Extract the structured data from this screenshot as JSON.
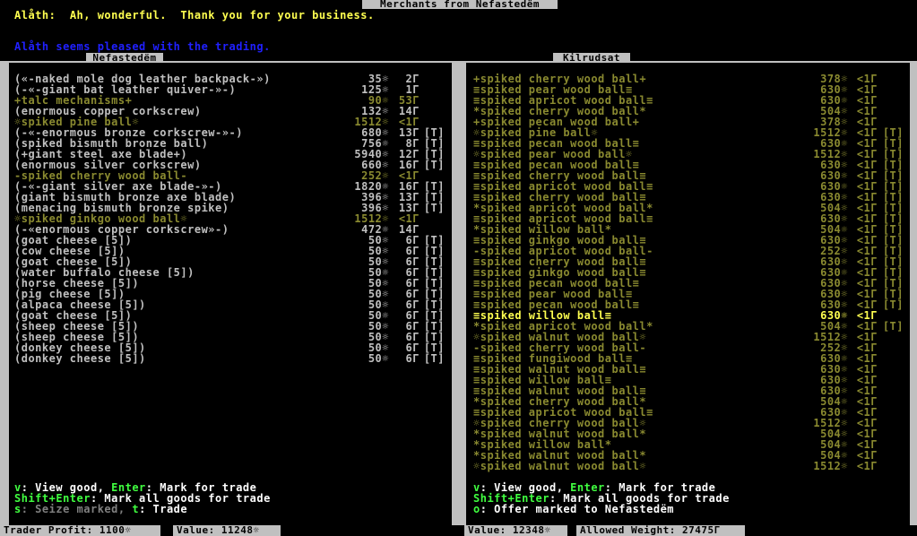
{
  "title": "Merchants from Nefastedëm",
  "messages": {
    "line1_speaker": "Alåth:",
    "line1_text": "Ah, wonderful.  Thank you for your business.",
    "line2": "Alåth seems pleased with the trading."
  },
  "left_panel": {
    "title": "Nefastedëm",
    "items": [
      {
        "name": "(«-naked mole dog leather backpack-»)",
        "value": "35☼",
        "weight": "2Γ",
        "flag": "",
        "color": "#c0c0c0"
      },
      {
        "name": "(-«-giant bat leather quiver-»-)",
        "value": "125☼",
        "weight": "1Γ",
        "flag": "",
        "color": "#c0c0c0"
      },
      {
        "name": "+talc mechanisms+",
        "value": "90☼",
        "weight": "53Γ",
        "flag": "",
        "color": "#8a8a30"
      },
      {
        "name": "(enormous copper corkscrew)",
        "value": "132☼",
        "weight": "14Γ",
        "flag": "",
        "color": "#c0c0c0"
      },
      {
        "name": "☼spiked pine ball☼",
        "value": "1512☼",
        "weight": "<1Γ",
        "flag": "",
        "color": "#8a8a30"
      },
      {
        "name": "(-«-enormous bronze corkscrew-»-)",
        "value": "680☼",
        "weight": "13Γ",
        "flag": "[T]",
        "color": "#c0c0c0"
      },
      {
        "name": "(spiked bismuth bronze ball)",
        "value": "756☼",
        "weight": "8Γ",
        "flag": "[T]",
        "color": "#c0c0c0"
      },
      {
        "name": "(+giant steel axe blade+)",
        "value": "5940☼",
        "weight": "12Γ",
        "flag": "[T]",
        "color": "#c0c0c0"
      },
      {
        "name": "(enormous silver corkscrew)",
        "value": "660☼",
        "weight": "16Γ",
        "flag": "[T]",
        "color": "#c0c0c0"
      },
      {
        "name": "-spiked cherry wood ball-",
        "value": "252☼",
        "weight": "<1Γ",
        "flag": "",
        "color": "#8a8a30"
      },
      {
        "name": "(-«-giant silver axe blade-»-)",
        "value": "1820☼",
        "weight": "16Γ",
        "flag": "[T]",
        "color": "#c0c0c0"
      },
      {
        "name": "(giant bismuth bronze axe blade)",
        "value": "396☼",
        "weight": "13Γ",
        "flag": "[T]",
        "color": "#c0c0c0"
      },
      {
        "name": "(menacing bismuth bronze spike)",
        "value": "396☼",
        "weight": "13Γ",
        "flag": "[T]",
        "color": "#c0c0c0"
      },
      {
        "name": "☼spiked ginkgo wood ball☼",
        "value": "1512☼",
        "weight": "<1Γ",
        "flag": "",
        "color": "#8a8a30"
      },
      {
        "name": "(-«enormous copper corkscrew»-)",
        "value": "472☼",
        "weight": "14Γ",
        "flag": "",
        "color": "#c0c0c0"
      },
      {
        "name": "(goat cheese [5])",
        "value": "50☼",
        "weight": "6Γ",
        "flag": "[T]",
        "color": "#c0c0c0"
      },
      {
        "name": "(cow cheese [5])",
        "value": "50☼",
        "weight": "6Γ",
        "flag": "[T]",
        "color": "#c0c0c0"
      },
      {
        "name": "(goat cheese [5])",
        "value": "50☼",
        "weight": "6Γ",
        "flag": "[T]",
        "color": "#c0c0c0"
      },
      {
        "name": "(water buffalo cheese [5])",
        "value": "50☼",
        "weight": "6Γ",
        "flag": "[T]",
        "color": "#c0c0c0"
      },
      {
        "name": "(horse cheese [5])",
        "value": "50☼",
        "weight": "6Γ",
        "flag": "[T]",
        "color": "#c0c0c0"
      },
      {
        "name": "(pig cheese [5])",
        "value": "50☼",
        "weight": "6Γ",
        "flag": "[T]",
        "color": "#c0c0c0"
      },
      {
        "name": "(alpaca cheese [5])",
        "value": "50☼",
        "weight": "6Γ",
        "flag": "[T]",
        "color": "#c0c0c0"
      },
      {
        "name": "(goat cheese [5])",
        "value": "50☼",
        "weight": "6Γ",
        "flag": "[T]",
        "color": "#c0c0c0"
      },
      {
        "name": "(sheep cheese [5])",
        "value": "50☼",
        "weight": "6Γ",
        "flag": "[T]",
        "color": "#c0c0c0"
      },
      {
        "name": "(sheep cheese [5])",
        "value": "50☼",
        "weight": "6Γ",
        "flag": "[T]",
        "color": "#c0c0c0"
      },
      {
        "name": "(donkey cheese [5])",
        "value": "50☼",
        "weight": "6Γ",
        "flag": "[T]",
        "color": "#c0c0c0"
      },
      {
        "name": "(donkey cheese [5])",
        "value": "50☼",
        "weight": "6Γ",
        "flag": "[T]",
        "color": "#c0c0c0"
      }
    ],
    "help": {
      "l1_key1": "v",
      "l1_t1": ": View good, ",
      "l1_key2": "Enter",
      "l1_t2": ": Mark for trade",
      "l2_key": "Shift+Enter",
      "l2_t": ": Mark all goods for trade",
      "l3_key1": "s",
      "l3_t1": ": Seize marked, ",
      "l3_key2": "t",
      "l3_t2": ": Trade"
    }
  },
  "right_panel": {
    "title": "Kilrudsat",
    "items": [
      {
        "name": "+spiked cherry wood ball+",
        "value": "378☼",
        "weight": "<1Γ",
        "flag": "",
        "color": "#8a8a30"
      },
      {
        "name": "≡spiked pear wood ball≡",
        "value": "630☼",
        "weight": "<1Γ",
        "flag": "",
        "color": "#8a8a30"
      },
      {
        "name": "≡spiked apricot wood ball≡",
        "value": "630☼",
        "weight": "<1Γ",
        "flag": "",
        "color": "#8a8a30"
      },
      {
        "name": "*spiked cherry wood ball*",
        "value": "504☼",
        "weight": "<1Γ",
        "flag": "",
        "color": "#8a8a30"
      },
      {
        "name": "+spiked pecan wood ball+",
        "value": "378☼",
        "weight": "<1Γ",
        "flag": "",
        "color": "#8a8a30"
      },
      {
        "name": "☼spiked pine ball☼",
        "value": "1512☼",
        "weight": "<1Γ",
        "flag": "[T]",
        "color": "#8a8a30"
      },
      {
        "name": "≡spiked pecan wood ball≡",
        "value": "630☼",
        "weight": "<1Γ",
        "flag": "[T]",
        "color": "#8a8a30"
      },
      {
        "name": "☼spiked pear wood ball☼",
        "value": "1512☼",
        "weight": "<1Γ",
        "flag": "[T]",
        "color": "#8a8a30"
      },
      {
        "name": "≡spiked pecan wood ball≡",
        "value": "630☼",
        "weight": "<1Γ",
        "flag": "[T]",
        "color": "#8a8a30"
      },
      {
        "name": "≡spiked cherry wood ball≡",
        "value": "630☼",
        "weight": "<1Γ",
        "flag": "[T]",
        "color": "#8a8a30"
      },
      {
        "name": "≡spiked apricot wood ball≡",
        "value": "630☼",
        "weight": "<1Γ",
        "flag": "[T]",
        "color": "#8a8a30"
      },
      {
        "name": "≡spiked cherry wood ball≡",
        "value": "630☼",
        "weight": "<1Γ",
        "flag": "[T]",
        "color": "#8a8a30"
      },
      {
        "name": "*spiked apricot wood ball*",
        "value": "504☼",
        "weight": "<1Γ",
        "flag": "[T]",
        "color": "#8a8a30"
      },
      {
        "name": "≡spiked apricot wood ball≡",
        "value": "630☼",
        "weight": "<1Γ",
        "flag": "[T]",
        "color": "#8a8a30"
      },
      {
        "name": "*spiked willow ball*",
        "value": "504☼",
        "weight": "<1Γ",
        "flag": "[T]",
        "color": "#8a8a30"
      },
      {
        "name": "≡spiked ginkgo wood ball≡",
        "value": "630☼",
        "weight": "<1Γ",
        "flag": "[T]",
        "color": "#8a8a30"
      },
      {
        "name": "-spiked apricot wood ball-",
        "value": "252☼",
        "weight": "<1Γ",
        "flag": "[T]",
        "color": "#8a8a30"
      },
      {
        "name": "≡spiked cherry wood ball≡",
        "value": "630☼",
        "weight": "<1Γ",
        "flag": "[T]",
        "color": "#8a8a30"
      },
      {
        "name": "≡spiked ginkgo wood ball≡",
        "value": "630☼",
        "weight": "<1Γ",
        "flag": "[T]",
        "color": "#8a8a30"
      },
      {
        "name": "≡spiked pecan wood ball≡",
        "value": "630☼",
        "weight": "<1Γ",
        "flag": "[T]",
        "color": "#8a8a30"
      },
      {
        "name": "≡spiked pear wood ball≡",
        "value": "630☼",
        "weight": "<1Γ",
        "flag": "[T]",
        "color": "#8a8a30"
      },
      {
        "name": "≡spiked pecan wood ball≡",
        "value": "630☼",
        "weight": "<1Γ",
        "flag": "[T]",
        "color": "#8a8a30"
      },
      {
        "name": "≡spiked willow ball≡",
        "value": "630☼",
        "weight": "<1Γ",
        "flag": "",
        "color": "#ffff50"
      },
      {
        "name": "*spiked apricot wood ball*",
        "value": "504☼",
        "weight": "<1Γ",
        "flag": "[T]",
        "color": "#8a8a30"
      },
      {
        "name": "☼spiked walnut wood ball☼",
        "value": "1512☼",
        "weight": "<1Γ",
        "flag": "",
        "color": "#8a8a30"
      },
      {
        "name": "-spiked cherry wood ball-",
        "value": "252☼",
        "weight": "<1Γ",
        "flag": "",
        "color": "#8a8a30"
      },
      {
        "name": "≡spiked fungiwood ball≡",
        "value": "630☼",
        "weight": "<1Γ",
        "flag": "",
        "color": "#8a8a30"
      },
      {
        "name": "≡spiked walnut wood ball≡",
        "value": "630☼",
        "weight": "<1Γ",
        "flag": "",
        "color": "#8a8a30"
      },
      {
        "name": "≡spiked willow ball≡",
        "value": "630☼",
        "weight": "<1Γ",
        "flag": "",
        "color": "#8a8a30"
      },
      {
        "name": "≡spiked walnut wood ball≡",
        "value": "630☼",
        "weight": "<1Γ",
        "flag": "",
        "color": "#8a8a30"
      },
      {
        "name": "*spiked cherry wood ball*",
        "value": "504☼",
        "weight": "<1Γ",
        "flag": "",
        "color": "#8a8a30"
      },
      {
        "name": "≡spiked apricot wood ball≡",
        "value": "630☼",
        "weight": "<1Γ",
        "flag": "",
        "color": "#8a8a30"
      },
      {
        "name": "☼spiked cherry wood ball☼",
        "value": "1512☼",
        "weight": "<1Γ",
        "flag": "",
        "color": "#8a8a30"
      },
      {
        "name": "*spiked walnut wood ball*",
        "value": "504☼",
        "weight": "<1Γ",
        "flag": "",
        "color": "#8a8a30"
      },
      {
        "name": "*spiked willow ball*",
        "value": "504☼",
        "weight": "<1Γ",
        "flag": "",
        "color": "#8a8a30"
      },
      {
        "name": "*spiked walnut wood ball*",
        "value": "504☼",
        "weight": "<1Γ",
        "flag": "",
        "color": "#8a8a30"
      },
      {
        "name": "☼spiked walnut wood ball☼",
        "value": "1512☼",
        "weight": "<1Γ",
        "flag": "",
        "color": "#8a8a30"
      }
    ],
    "help": {
      "l1_key1": "v",
      "l1_t1": ": View good, ",
      "l1_key2": "Enter",
      "l1_t2": ": Mark for trade",
      "l2_key": "Shift+Enter",
      "l2_t": ": Mark all goods for trade",
      "l3_key": "o",
      "l3_t": ": Offer marked to Nefastedëm"
    }
  },
  "status": {
    "trader_profit": "Trader Profit: 1100☼",
    "left_value": "Value: 11248☼",
    "right_value": "Value: 12348☼",
    "allowed_weight": "Allowed Weight: 27475Γ"
  },
  "colors": {
    "title_yellow": "#ffff50",
    "message_blue": "#2020ff",
    "item_gray": "#c0c0c0",
    "item_olive": "#8a8a30",
    "highlight": "#ffff50",
    "key_green": "#40ff40"
  }
}
